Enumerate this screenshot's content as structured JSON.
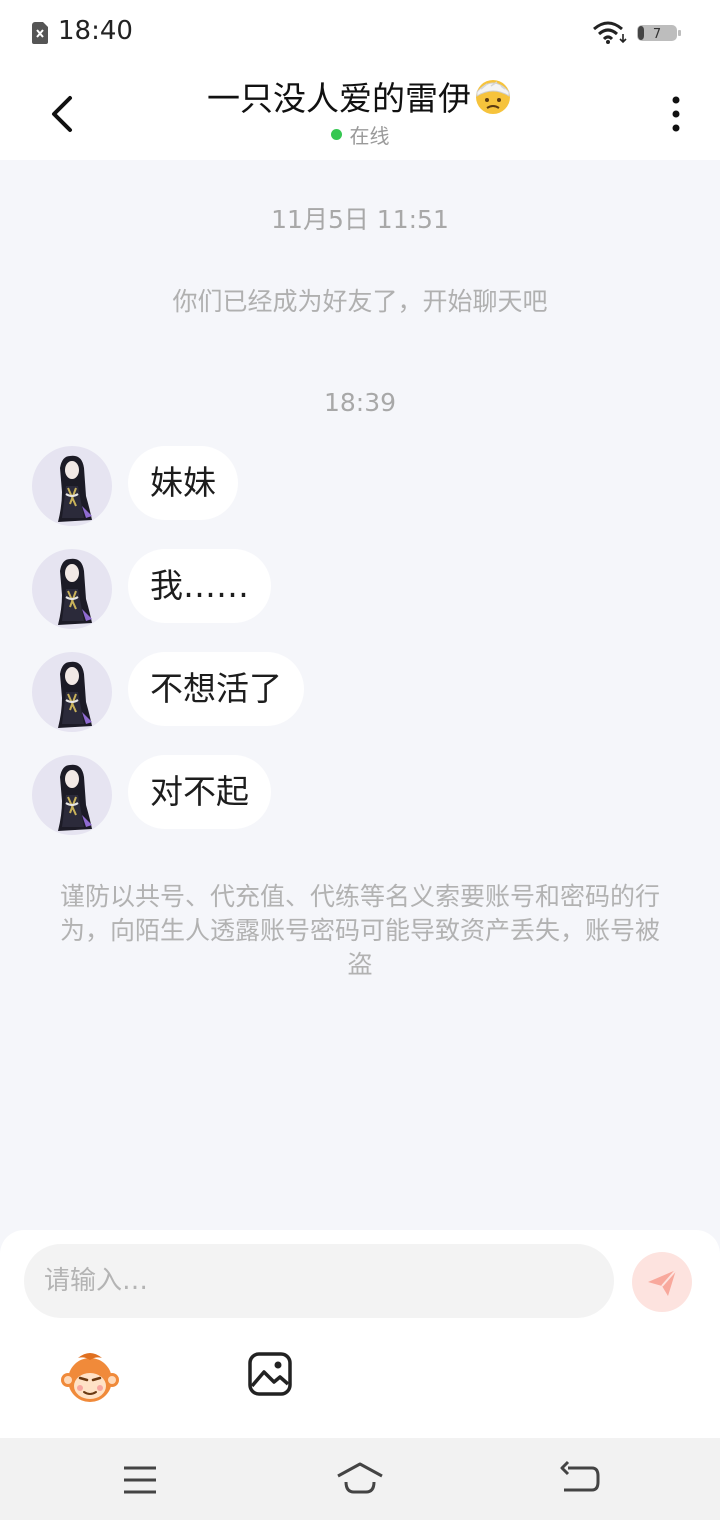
{
  "status_bar": {
    "time": "18:40",
    "battery_level": "7"
  },
  "header": {
    "title": "一只没人爱的雷伊",
    "title_emoji": "bandaged-face-emoji",
    "status": "在线",
    "status_color": "#36c752"
  },
  "chat": {
    "first_timestamp": "11月5日 11:51",
    "friend_notice": "你们已经成为好友了，开始聊天吧",
    "second_timestamp": "18:39",
    "messages": [
      {
        "sender": "received",
        "text": "妹妹"
      },
      {
        "sender": "received",
        "text": "我……"
      },
      {
        "sender": "received",
        "text": "不想活了"
      },
      {
        "sender": "received",
        "text": "对不起"
      }
    ],
    "safety_warning": "谨防以共号、代充值、代练等名义索要账号和密码的行为，向陌生人透露账号密码可能导致资产丢失，账号被盗"
  },
  "composer": {
    "placeholder": "请输入…",
    "value": "",
    "send_icon": "paper-plane-icon",
    "tool_icons": [
      "monkey-sticker-icon",
      "image-icon"
    ]
  },
  "nav_bar": {
    "icons": [
      "menu-icon",
      "home-icon",
      "back-icon"
    ]
  },
  "colors": {
    "background": "#f5f6fa",
    "bubble": "#ffffff",
    "send_button": "#fde3df",
    "send_arrow": "#f8a89c"
  }
}
